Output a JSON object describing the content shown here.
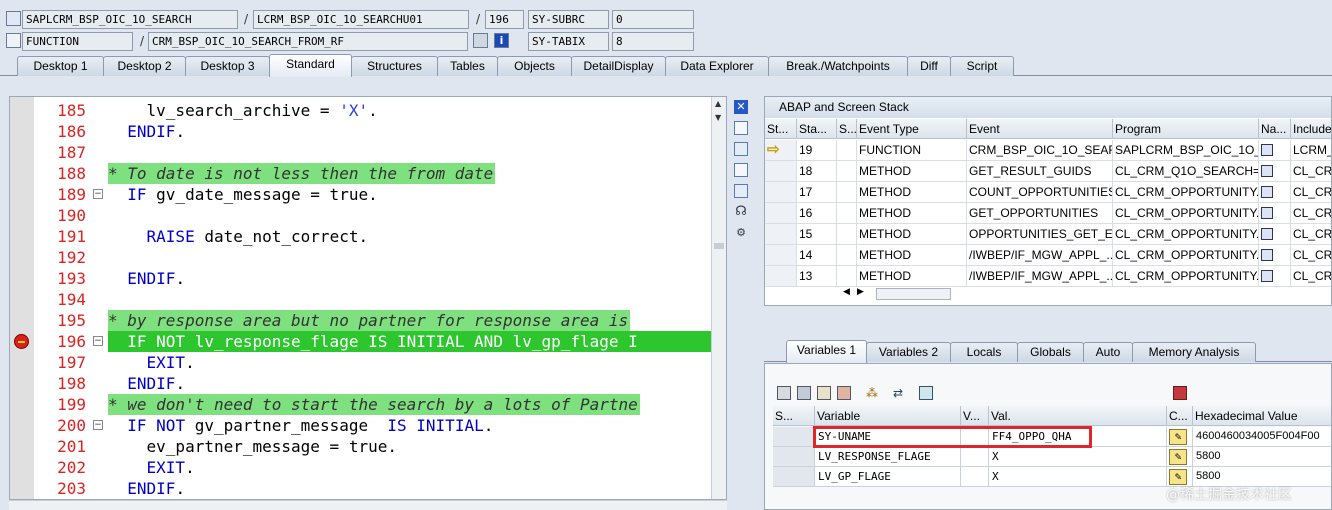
{
  "header": {
    "program": "SAPLCRM_BSP_OIC_1O_SEARCH",
    "include": "LCRM_BSP_OIC_1O_SEARCHU01",
    "line": "196",
    "sy_subrc_label": "SY-SUBRC",
    "sy_subrc_value": "0",
    "type": "FUNCTION",
    "function_name": "CRM_BSP_OIC_1O_SEARCH_FROM_RF",
    "sy_tabix_label": "SY-TABIX",
    "sy_tabix_value": "8",
    "slash": "/"
  },
  "tabs": [
    "Desktop 1",
    "Desktop 2",
    "Desktop 3",
    "Standard",
    "Structures",
    "Tables",
    "Objects",
    "DetailDisplay",
    "Data Explorer",
    "Break./Watchpoints",
    "Diff",
    "Script"
  ],
  "active_tab": "Standard",
  "code_lines": [
    {
      "num": "185",
      "text": "    lv_search_archive = 'X'."
    },
    {
      "num": "186",
      "text": "  ENDIF."
    },
    {
      "num": "187",
      "text": ""
    },
    {
      "num": "188",
      "text": "* To date is not less then the from date"
    },
    {
      "num": "189",
      "text": "  IF gv_date_message = true."
    },
    {
      "num": "190",
      "text": ""
    },
    {
      "num": "191",
      "text": "    RAISE date_not_correct."
    },
    {
      "num": "192",
      "text": ""
    },
    {
      "num": "193",
      "text": "  ENDIF."
    },
    {
      "num": "194",
      "text": ""
    },
    {
      "num": "195",
      "text": "* by response area but no partner for response area is"
    },
    {
      "num": "196",
      "text": "  IF NOT lv_response_flage IS INITIAL AND lv_gp_flage I"
    },
    {
      "num": "197",
      "text": "    EXIT."
    },
    {
      "num": "198",
      "text": "  ENDIF."
    },
    {
      "num": "199",
      "text": "* we don't need to start the search by a lots of Partne"
    },
    {
      "num": "200",
      "text": "  IF NOT gv_partner_message  IS INITIAL."
    },
    {
      "num": "201",
      "text": "    ev_partner_message = true."
    },
    {
      "num": "202",
      "text": "    EXIT."
    },
    {
      "num": "203",
      "text": "  ENDIF."
    }
  ],
  "stack": {
    "title": "ABAP and Screen Stack",
    "columns": [
      "St...",
      "Sta...",
      "S...",
      "Event Type",
      "Event",
      "Program",
      "Na...",
      "Include"
    ],
    "rows": [
      {
        "sta": "19",
        "type": "FUNCTION",
        "event": "CRM_BSP_OIC_1O_SEAR...",
        "program": "SAPLCRM_BSP_OIC_1O_...",
        "include": "LCRM_B"
      },
      {
        "sta": "18",
        "type": "METHOD",
        "event": "GET_RESULT_GUIDS",
        "program": "CL_CRM_Q1O_SEARCH=...",
        "include": "CL_CRM"
      },
      {
        "sta": "17",
        "type": "METHOD",
        "event": "COUNT_OPPORTUNITIES",
        "program": "CL_CRM_OPPORTUNITY...",
        "include": "CL_CRM"
      },
      {
        "sta": "16",
        "type": "METHOD",
        "event": "GET_OPPORTUNITIES",
        "program": "CL_CRM_OPPORTUNITY...",
        "include": "CL_CRM"
      },
      {
        "sta": "15",
        "type": "METHOD",
        "event": "OPPORTUNITIES_GET_E...",
        "program": "CL_CRM_OPPORTUNITY...",
        "include": "CL_CRM"
      },
      {
        "sta": "14",
        "type": "METHOD",
        "event": "/IWBEP/IF_MGW_APPL_...",
        "program": "CL_CRM_OPPORTUNITY...",
        "include": "CL_CRM"
      },
      {
        "sta": "13",
        "type": "METHOD",
        "event": "/IWBEP/IF_MGW_APPL_...",
        "program": "CL_CRM_OPPORTUNITY...",
        "include": "CL_CRM"
      }
    ]
  },
  "var_tabs": [
    "Variables 1",
    "Variables 2",
    "Locals",
    "Globals",
    "Auto",
    "Memory Analysis"
  ],
  "active_var_tab": "Variables 1",
  "variables": {
    "columns": [
      "S...",
      "Variable",
      "V...",
      "Val.",
      "C...",
      "Hexadecimal Value"
    ],
    "rows": [
      {
        "name": "SY-UNAME",
        "value": "FF4_OPPO_QHA",
        "hex": "4600460034005F004F00"
      },
      {
        "name": "LV_RESPONSE_FLAGE",
        "value": "X",
        "hex": "5800"
      },
      {
        "name": "LV_GP_FLAGE",
        "value": "X",
        "hex": "5800"
      }
    ]
  },
  "watermark": "@稀土掘金技术社区",
  "colors": {
    "highlight_green": "#2ec62e",
    "comment_green": "#7ee07e",
    "line_number_red": "#dd2222",
    "selection_red": "#e0262d"
  }
}
